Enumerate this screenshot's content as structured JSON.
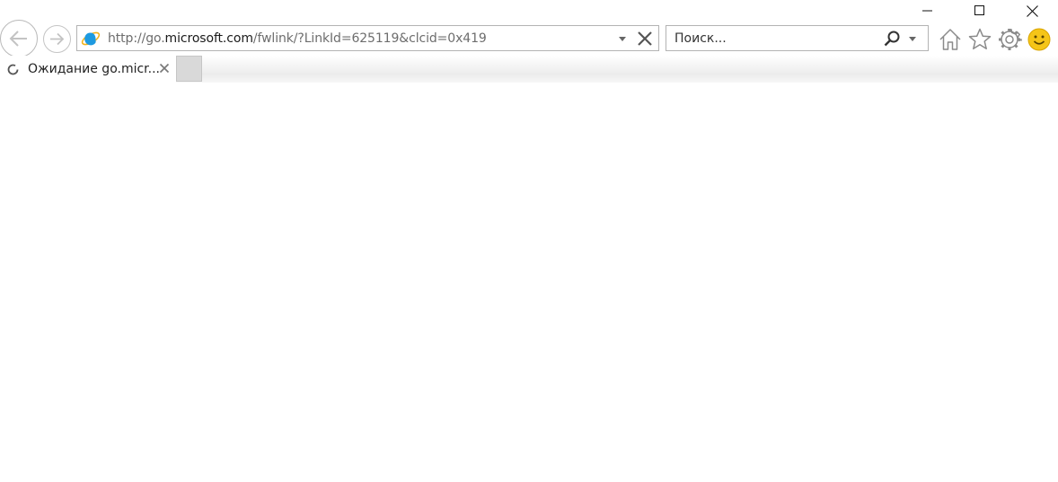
{
  "window": {
    "minimize_icon": "minimize-icon",
    "maximize_icon": "maximize-icon",
    "close_icon": "close-icon"
  },
  "nav": {
    "back_icon": "back-arrow-icon",
    "forward_icon": "forward-arrow-icon"
  },
  "address": {
    "prefix": "http://go.",
    "host": "microsoft.com",
    "path": "/fwlink/?LinkId=625119&clcid=0x419",
    "site_icon": "internet-explorer-icon"
  },
  "search": {
    "placeholder": "Поиск...",
    "icon": "search-icon"
  },
  "toolbar": {
    "icons": [
      "home-icon",
      "favorites-star-icon",
      "tools-gear-icon",
      "feedback-smiley-icon"
    ]
  },
  "tabs": [
    {
      "title": "Ожидание go.micr...",
      "status": "loading"
    }
  ],
  "colors": {
    "accent_ie_blue": "#1e9ae0",
    "smiley_yellow": "#f5c518",
    "icon_gray": "#8a8a8a"
  }
}
